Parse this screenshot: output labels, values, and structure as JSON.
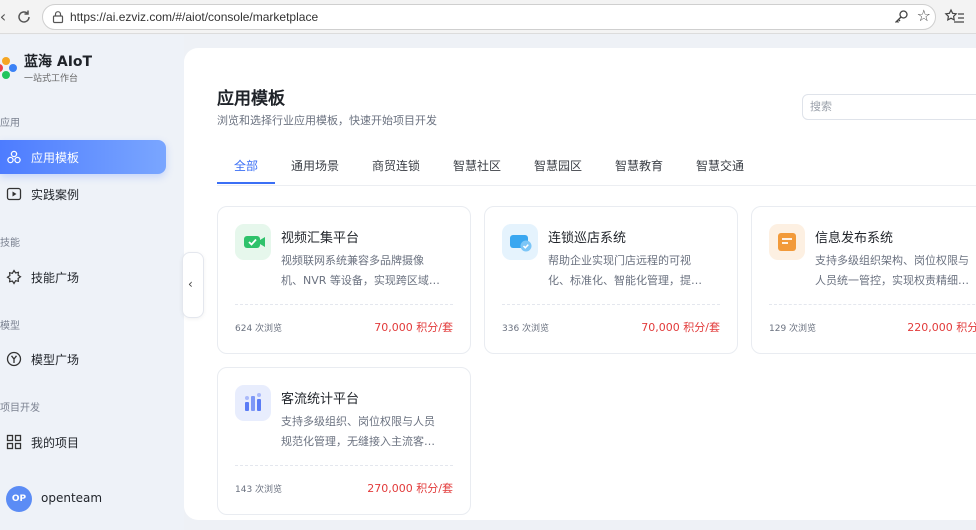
{
  "browser": {
    "url": "https://ai.ezviz.com/#/aiot/console/marketplace"
  },
  "brand": {
    "title": "蓝海 AIoT",
    "subtitle": "一站式工作台"
  },
  "sidebar": {
    "groups": [
      {
        "label": "应用",
        "items": [
          {
            "label": "应用模板",
            "icon": "app-template-icon",
            "active": true
          },
          {
            "label": "实践案例",
            "icon": "play-case-icon",
            "active": false
          }
        ]
      },
      {
        "label": "技能",
        "items": [
          {
            "label": "技能广场",
            "icon": "skill-icon",
            "active": false
          }
        ]
      },
      {
        "label": "模型",
        "items": [
          {
            "label": "模型广场",
            "icon": "model-icon",
            "active": false
          }
        ]
      },
      {
        "label": "项目开发",
        "items": [
          {
            "label": "我的项目",
            "icon": "project-grid-icon",
            "active": false
          }
        ]
      }
    ]
  },
  "user": {
    "avatar_text": "OP",
    "name": "openteam"
  },
  "page": {
    "title": "应用模板",
    "subtitle": "浏览和选择行业应用模板，快速开始项目开发"
  },
  "search": {
    "placeholder": "搜索"
  },
  "tabs": [
    {
      "label": "全部",
      "active": true
    },
    {
      "label": "通用场景",
      "active": false
    },
    {
      "label": "商贸连锁",
      "active": false
    },
    {
      "label": "智慧社区",
      "active": false
    },
    {
      "label": "智慧园区",
      "active": false
    },
    {
      "label": "智慧教育",
      "active": false
    },
    {
      "label": "智慧交通",
      "active": false
    }
  ],
  "cards": [
    {
      "title": "视频汇集平台",
      "desc1": "视频联网系统兼容多品牌摄像",
      "desc2": "机、NVR 等设备，实现跨区域…",
      "views": "624 次浏览",
      "price": "70,000 积分/套",
      "icon": "video-hub-icon",
      "color": "#2fc26b"
    },
    {
      "title": "连锁巡店系统",
      "desc1": "帮助企业实现门店远程的可视",
      "desc2": "化、标准化、智能化管理，提…",
      "views": "336 次浏览",
      "price": "70,000 积分/套",
      "icon": "store-patrol-icon",
      "color": "#3aa7f0"
    },
    {
      "title": "信息发布系统",
      "desc1": "支持多级组织架构、岗位权限与",
      "desc2": "人员统一管控，实现权责精细…",
      "views": "129 次浏览",
      "price": "220,000 积分/",
      "icon": "info-publish-icon",
      "color": "#f29a3a"
    },
    {
      "title": "客流统计平台",
      "desc1": "支持多级组织、岗位权限与人员",
      "desc2": "规范化管理，无缝接入主流客…",
      "views": "143 次浏览",
      "price": "270,000 积分/套",
      "icon": "traffic-stats-icon",
      "color": "#5b7cf5"
    }
  ]
}
